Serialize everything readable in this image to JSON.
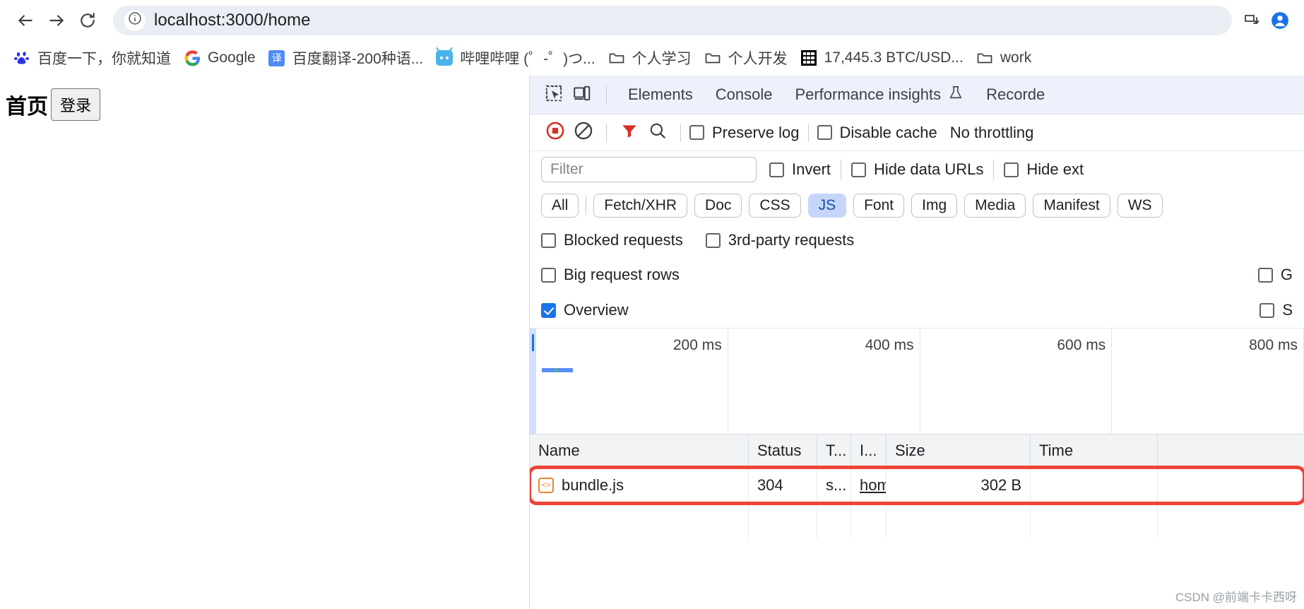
{
  "browser": {
    "back_icon": "back-arrow-icon",
    "forward_icon": "forward-arrow-icon",
    "reload_icon": "reload-icon",
    "site_info_icon": "site-info-icon",
    "url": "localhost:3000/home",
    "install_icon": "install-app-icon",
    "profile_icon": "profile-avatar-icon"
  },
  "bookmarks": [
    {
      "label": "百度一下，你就知道",
      "icon": "baidu-icon"
    },
    {
      "label": "Google",
      "icon": "google-icon"
    },
    {
      "label": "百度翻译-200种语...",
      "icon": "baidu-translate-icon"
    },
    {
      "label": "哔哩哔哩 (゜-゜)つ...",
      "icon": "bilibili-icon"
    },
    {
      "label": "个人学习",
      "icon": "folder-icon"
    },
    {
      "label": "个人开发",
      "icon": "folder-icon"
    },
    {
      "label": "17,445.3 BTC/USD...",
      "icon": "qr-icon"
    },
    {
      "label": "work",
      "icon": "folder-icon"
    }
  ],
  "page": {
    "heading": "首页",
    "login_button": "登录"
  },
  "devtools": {
    "inspect_icon": "inspect-element-icon",
    "device_icon": "device-toolbar-icon",
    "tabs": [
      {
        "label": "Elements"
      },
      {
        "label": "Console"
      },
      {
        "label": "Performance insights",
        "badge_icon": "flask-icon"
      },
      {
        "label": "Recorde"
      }
    ],
    "toolbar": {
      "record_icon": "record-stop-icon",
      "clear_icon": "clear-network-icon",
      "filter_icon": "filter-funnel-icon",
      "search_icon": "search-icon",
      "preserve_log": {
        "label": "Preserve log",
        "checked": false
      },
      "disable_cache": {
        "label": "Disable cache",
        "checked": false
      },
      "throttling": "No throttling"
    },
    "filter": {
      "placeholder": "Filter",
      "value": "",
      "invert": {
        "label": "Invert",
        "checked": false
      },
      "hide_data_urls": {
        "label": "Hide data URLs",
        "checked": false
      },
      "hide_ext": {
        "label": "Hide ext",
        "checked": false
      }
    },
    "type_pills": [
      {
        "label": "All",
        "active": false
      },
      {
        "label": "Fetch/XHR",
        "active": false
      },
      {
        "label": "Doc",
        "active": false
      },
      {
        "label": "CSS",
        "active": false
      },
      {
        "label": "JS",
        "active": true
      },
      {
        "label": "Font",
        "active": false
      },
      {
        "label": "Img",
        "active": false
      },
      {
        "label": "Media",
        "active": false
      },
      {
        "label": "Manifest",
        "active": false
      },
      {
        "label": "WS",
        "active": false
      }
    ],
    "request_opts": {
      "blocked_requests": {
        "label": "Blocked requests",
        "checked": false
      },
      "third_party": {
        "label": "3rd-party requests",
        "checked": false
      }
    },
    "view_opts": {
      "big_request_rows": {
        "label": "Big request rows",
        "checked": false
      },
      "group_by_frame": {
        "label": "G",
        "checked": false
      },
      "overview": {
        "label": "Overview",
        "checked": true
      },
      "capture_screenshots": {
        "label": "S",
        "checked": false
      }
    },
    "overview": {
      "ticks": [
        "200 ms",
        "400 ms",
        "600 ms",
        "800 ms"
      ]
    },
    "table": {
      "headers": [
        "Name",
        "Status",
        "T...",
        "I...",
        "Size",
        "Time"
      ],
      "rows": [
        {
          "name": "bundle.js",
          "icon": "js-file-icon",
          "status": "304",
          "type": "s...",
          "initiator": "hom",
          "size": "302 B",
          "time": "",
          "highlighted": true
        }
      ]
    }
  },
  "watermark": "CSDN @前端卡卡西呀",
  "colors": {
    "accent_blue": "#1a73e8",
    "record_red": "#d93025",
    "highlight_red": "#ef4437",
    "pill_active_bg": "#c6d6fb",
    "devtools_tabbar_bg": "#eef1fb"
  }
}
